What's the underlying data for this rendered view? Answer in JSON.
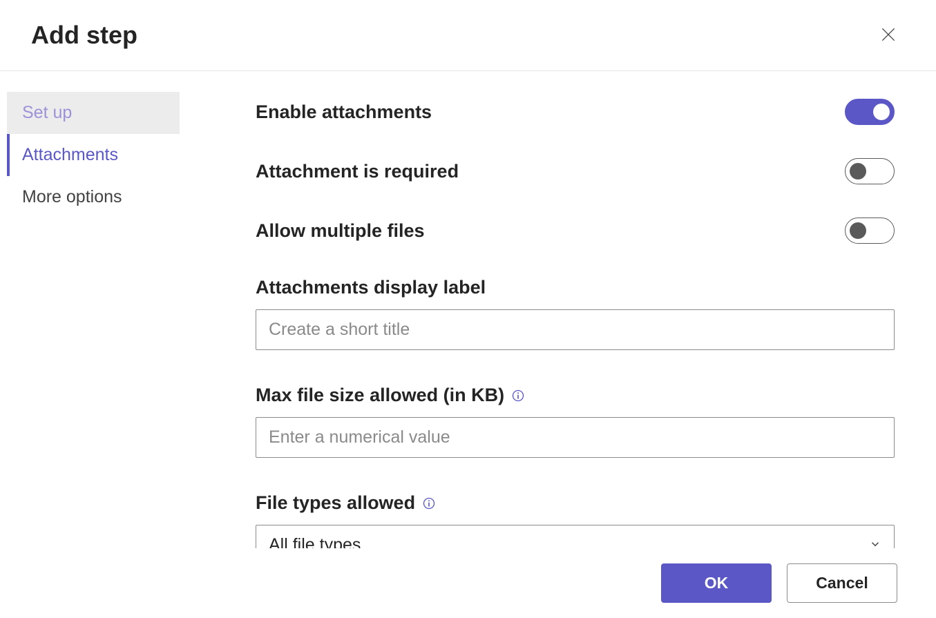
{
  "dialog": {
    "title": "Add step"
  },
  "sidebar": {
    "items": [
      {
        "label": "Set up",
        "state": "visited"
      },
      {
        "label": "Attachments",
        "state": "active"
      },
      {
        "label": "More options",
        "state": "default"
      }
    ]
  },
  "form": {
    "enable_attachments": {
      "label": "Enable attachments",
      "value": true
    },
    "attachment_required": {
      "label": "Attachment is required",
      "value": false
    },
    "allow_multiple": {
      "label": "Allow multiple files",
      "value": false
    },
    "display_label": {
      "label": "Attachments display label",
      "placeholder": "Create a short title",
      "value": ""
    },
    "max_file_size": {
      "label": "Max file size allowed (in KB)",
      "placeholder": "Enter a numerical value",
      "value": ""
    },
    "file_types": {
      "label": "File types allowed",
      "selected": "All file types"
    }
  },
  "footer": {
    "ok_label": "OK",
    "cancel_label": "Cancel"
  },
  "icons": {
    "close": "close-icon",
    "info": "info-icon",
    "chevron_down": "chevron-down-icon"
  },
  "colors": {
    "accent": "#5b57c7",
    "text": "#242424",
    "muted": "#8a8a8a",
    "visited_bg": "#ececec"
  }
}
